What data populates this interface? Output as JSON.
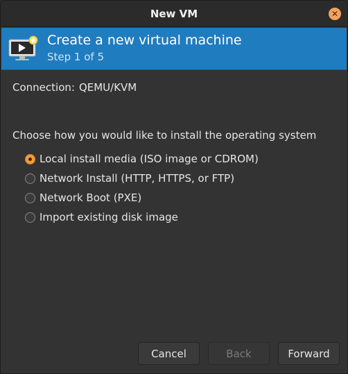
{
  "window": {
    "title": "New VM"
  },
  "titlebar": {
    "close_glyph": "✕"
  },
  "banner": {
    "icon": "new-vm-monitor-icon",
    "title": "Create a new virtual machine",
    "step": "Step 1 of 5"
  },
  "connection": {
    "label": "Connection:",
    "value": "QEMU/KVM"
  },
  "install": {
    "question": "Choose how you would like to install the operating system",
    "options": [
      {
        "label": "Local install media (ISO image or CDROM)",
        "selected": true
      },
      {
        "label": "Network Install (HTTP, HTTPS, or FTP)",
        "selected": false
      },
      {
        "label": "Network Boot (PXE)",
        "selected": false
      },
      {
        "label": "Import existing disk image",
        "selected": false
      }
    ]
  },
  "buttons": {
    "cancel": "Cancel",
    "back": "Back",
    "forward": "Forward"
  },
  "colors": {
    "banner": "#1f7cbf",
    "accent_radio": "#f29b3d",
    "close_button": "#f6a15c"
  }
}
